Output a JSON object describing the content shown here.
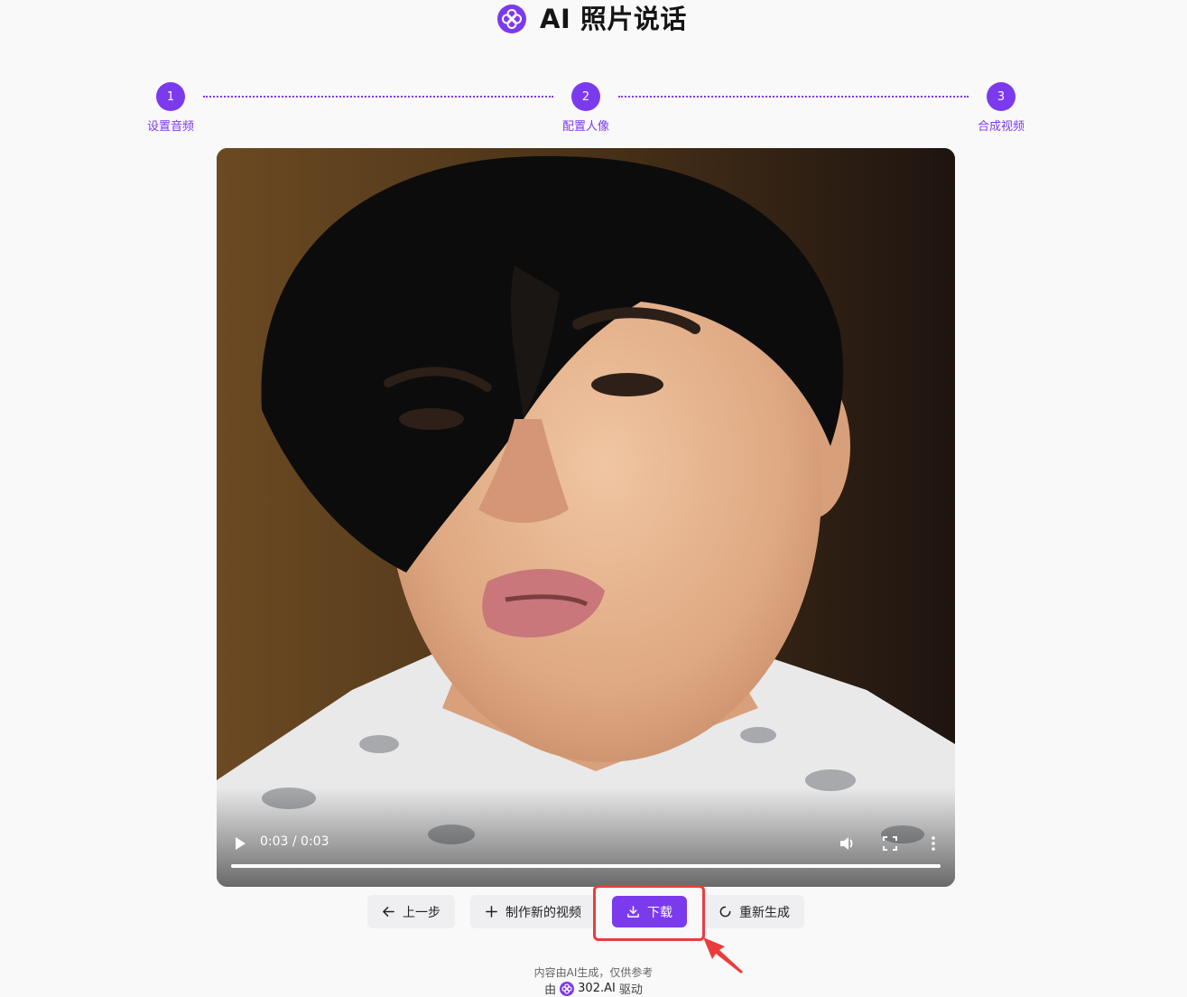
{
  "app": {
    "title": "AI 照片说话",
    "accent_color": "#7c3aed",
    "logo_icon": "four-petal-flower-icon"
  },
  "stepper": {
    "steps": [
      {
        "number": "1",
        "label": "设置音频"
      },
      {
        "number": "2",
        "label": "配置人像"
      },
      {
        "number": "3",
        "label": "合成视频"
      }
    ],
    "current_step": 3
  },
  "video": {
    "time_display": "0:03 / 0:03",
    "progress_fraction": 1.0,
    "controls": [
      "play-icon",
      "volume-icon",
      "fullscreen-icon",
      "more-vertical-icon"
    ]
  },
  "actions": {
    "back_label": "上一步",
    "new_video_label": "制作新的视频",
    "download_label": "下载",
    "regenerate_label": "重新生成",
    "highlight_color": "#ea3c3c"
  },
  "footer": {
    "disclaimer": "内容由AI生成，仅供参考",
    "powered_prefix": "由",
    "brand": "302.AI",
    "powered_suffix": "驱动"
  }
}
